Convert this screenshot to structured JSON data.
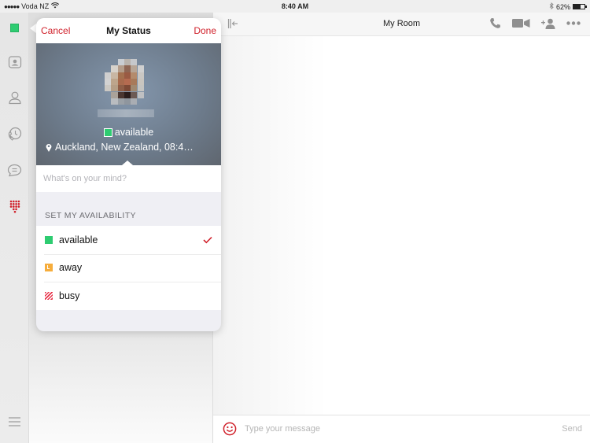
{
  "status_bar": {
    "carrier": "Voda NZ",
    "time": "8:40 AM",
    "battery_percent_label": "62%",
    "battery_level": 0.62
  },
  "rail": {
    "items": [
      {
        "name": "my-status",
        "icon": "green-status-square"
      },
      {
        "name": "contacts-book",
        "icon": "contact-card-icon"
      },
      {
        "name": "people",
        "icon": "person-icon"
      },
      {
        "name": "call-history",
        "icon": "phone-clock-icon"
      },
      {
        "name": "chats",
        "icon": "chat-bubble-icon"
      },
      {
        "name": "dialpad",
        "icon": "dialpad-icon",
        "active": true
      }
    ],
    "menu_icon": "hamburger-menu-icon"
  },
  "main": {
    "title": "My Room",
    "collapse_icon": "collapse-sidebar-icon",
    "actions": [
      {
        "name": "call",
        "icon": "phone-icon"
      },
      {
        "name": "video",
        "icon": "video-camera-icon"
      },
      {
        "name": "add-person",
        "icon": "add-person-icon"
      },
      {
        "name": "more",
        "icon": "more-dots-icon"
      }
    ],
    "composer": {
      "placeholder": "Type your message",
      "value": "",
      "send_label": "Send",
      "emoji_icon": "smiley-icon"
    }
  },
  "popover": {
    "cancel_label": "Cancel",
    "title": "My Status",
    "done_label": "Done",
    "profile": {
      "status_text": "available",
      "location_text": "Auckland, New Zealand, 08:4…"
    },
    "mind_input": {
      "placeholder": "What's on your mind?",
      "value": ""
    },
    "section_header": "SET MY AVAILABILITY",
    "options": [
      {
        "label": "available",
        "icon": "available-status-icon",
        "selected": true
      },
      {
        "label": "away",
        "icon": "away-status-icon",
        "selected": false
      },
      {
        "label": "busy",
        "icon": "busy-status-icon",
        "selected": false
      }
    ]
  },
  "colors": {
    "accent": "#d0202a",
    "available": "#2ecc71",
    "away": "#f6ad3c",
    "busy": "#e8334a"
  }
}
